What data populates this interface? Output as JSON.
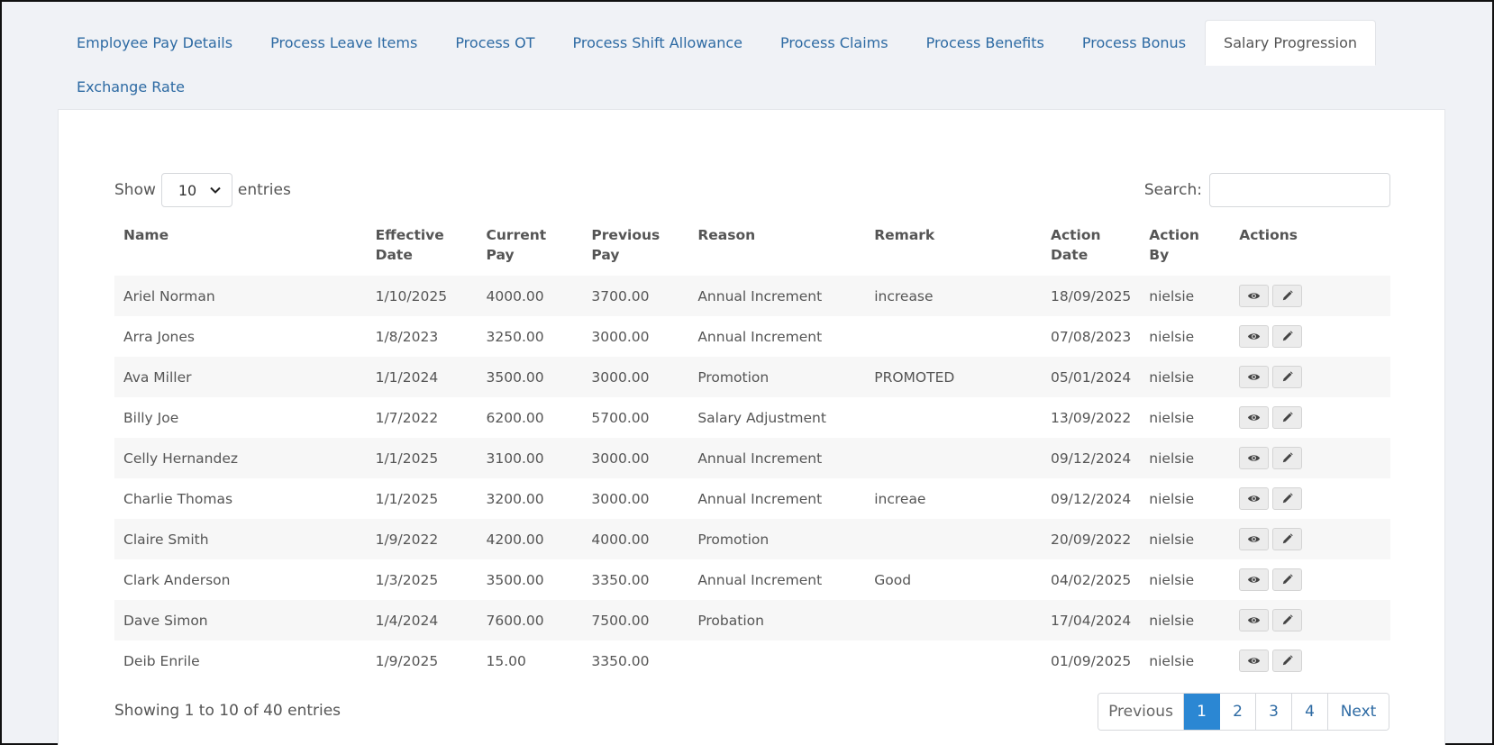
{
  "tabs": [
    {
      "label": "Employee Pay Details",
      "active": false
    },
    {
      "label": "Process Leave Items",
      "active": false
    },
    {
      "label": "Process OT",
      "active": false
    },
    {
      "label": "Process Shift Allowance",
      "active": false
    },
    {
      "label": "Process Claims",
      "active": false
    },
    {
      "label": "Process Benefits",
      "active": false
    },
    {
      "label": "Process Bonus",
      "active": false
    },
    {
      "label": "Salary Progression",
      "active": true
    },
    {
      "label": "Exchange Rate",
      "active": false
    }
  ],
  "length_menu": {
    "show_label": "Show",
    "value": "10",
    "entries_label": "entries"
  },
  "search": {
    "label": "Search:",
    "value": ""
  },
  "table": {
    "headers": [
      "Name",
      "Effective Date",
      "Current Pay",
      "Previous Pay",
      "Reason",
      "Remark",
      "Action Date",
      "Action By",
      "Actions"
    ],
    "rows": [
      [
        "Ariel Norman",
        "1/10/2025",
        "4000.00",
        "3700.00",
        "Annual Increment",
        "increase",
        "18/09/2025",
        "nielsie"
      ],
      [
        "Arra Jones",
        "1/8/2023",
        "3250.00",
        "3000.00",
        "Annual Increment",
        "",
        "07/08/2023",
        "nielsie"
      ],
      [
        "Ava Miller",
        "1/1/2024",
        "3500.00",
        "3000.00",
        "Promotion",
        "PROMOTED",
        "05/01/2024",
        "nielsie"
      ],
      [
        "Billy Joe",
        "1/7/2022",
        "6200.00",
        "5700.00",
        "Salary Adjustment",
        "",
        "13/09/2022",
        "nielsie"
      ],
      [
        "Celly Hernandez",
        "1/1/2025",
        "3100.00",
        "3000.00",
        "Annual Increment",
        "",
        "09/12/2024",
        "nielsie"
      ],
      [
        "Charlie Thomas",
        "1/1/2025",
        "3200.00",
        "3000.00",
        "Annual Increment",
        "increae",
        "09/12/2024",
        "nielsie"
      ],
      [
        "Claire Smith",
        "1/9/2022",
        "4200.00",
        "4000.00",
        "Promotion",
        "",
        "20/09/2022",
        "nielsie"
      ],
      [
        "Clark Anderson",
        "1/3/2025",
        "3500.00",
        "3350.00",
        "Annual Increment",
        "Good",
        "04/02/2025",
        "nielsie"
      ],
      [
        "Dave Simon",
        "1/4/2024",
        "7600.00",
        "7500.00",
        "Probation",
        "",
        "17/04/2024",
        "nielsie"
      ],
      [
        "Deib Enrile",
        "1/9/2025",
        "15.00",
        "3350.00",
        "",
        "",
        "01/09/2025",
        "nielsie"
      ]
    ],
    "row_actions": [
      "eye-icon",
      "pencil-icon"
    ]
  },
  "info": "Showing 1 to 10 of 40 entries",
  "pagination": {
    "previous": "Previous",
    "pages": [
      "1",
      "2",
      "3",
      "4"
    ],
    "current": "1",
    "next": "Next"
  },
  "colors": {
    "link": "#2d6aa3",
    "active_page": "#2b87d3",
    "stripe": "#f7f7f7",
    "background": "#f0f2f6"
  }
}
